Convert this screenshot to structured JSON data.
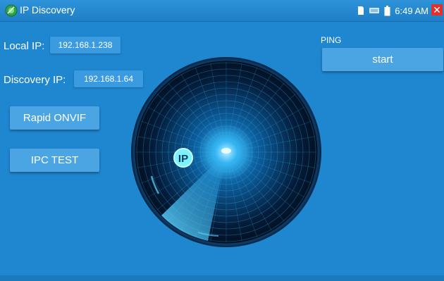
{
  "titlebar": {
    "title": "IP Discovery",
    "time": "6:49 AM",
    "icons": [
      "app-icon",
      "sd-card-icon",
      "network-icon",
      "battery-icon",
      "close-icon"
    ]
  },
  "local_ip": {
    "label": "Local IP:",
    "value": "192.168.1.238"
  },
  "discovery_ip": {
    "label": "Discovery IP:",
    "value": "192.168.1.64"
  },
  "buttons": {
    "rapid_onvif": "Rapid ONVIF",
    "ipc_test": "IPC TEST"
  },
  "ping": {
    "label": "PING",
    "start": "start"
  },
  "radar": {
    "badge": "IP"
  },
  "colors": {
    "background": "#1f86d0",
    "button": "#4ba5e3",
    "close": "#e0312c",
    "radar_glow": "#39c6ff"
  }
}
